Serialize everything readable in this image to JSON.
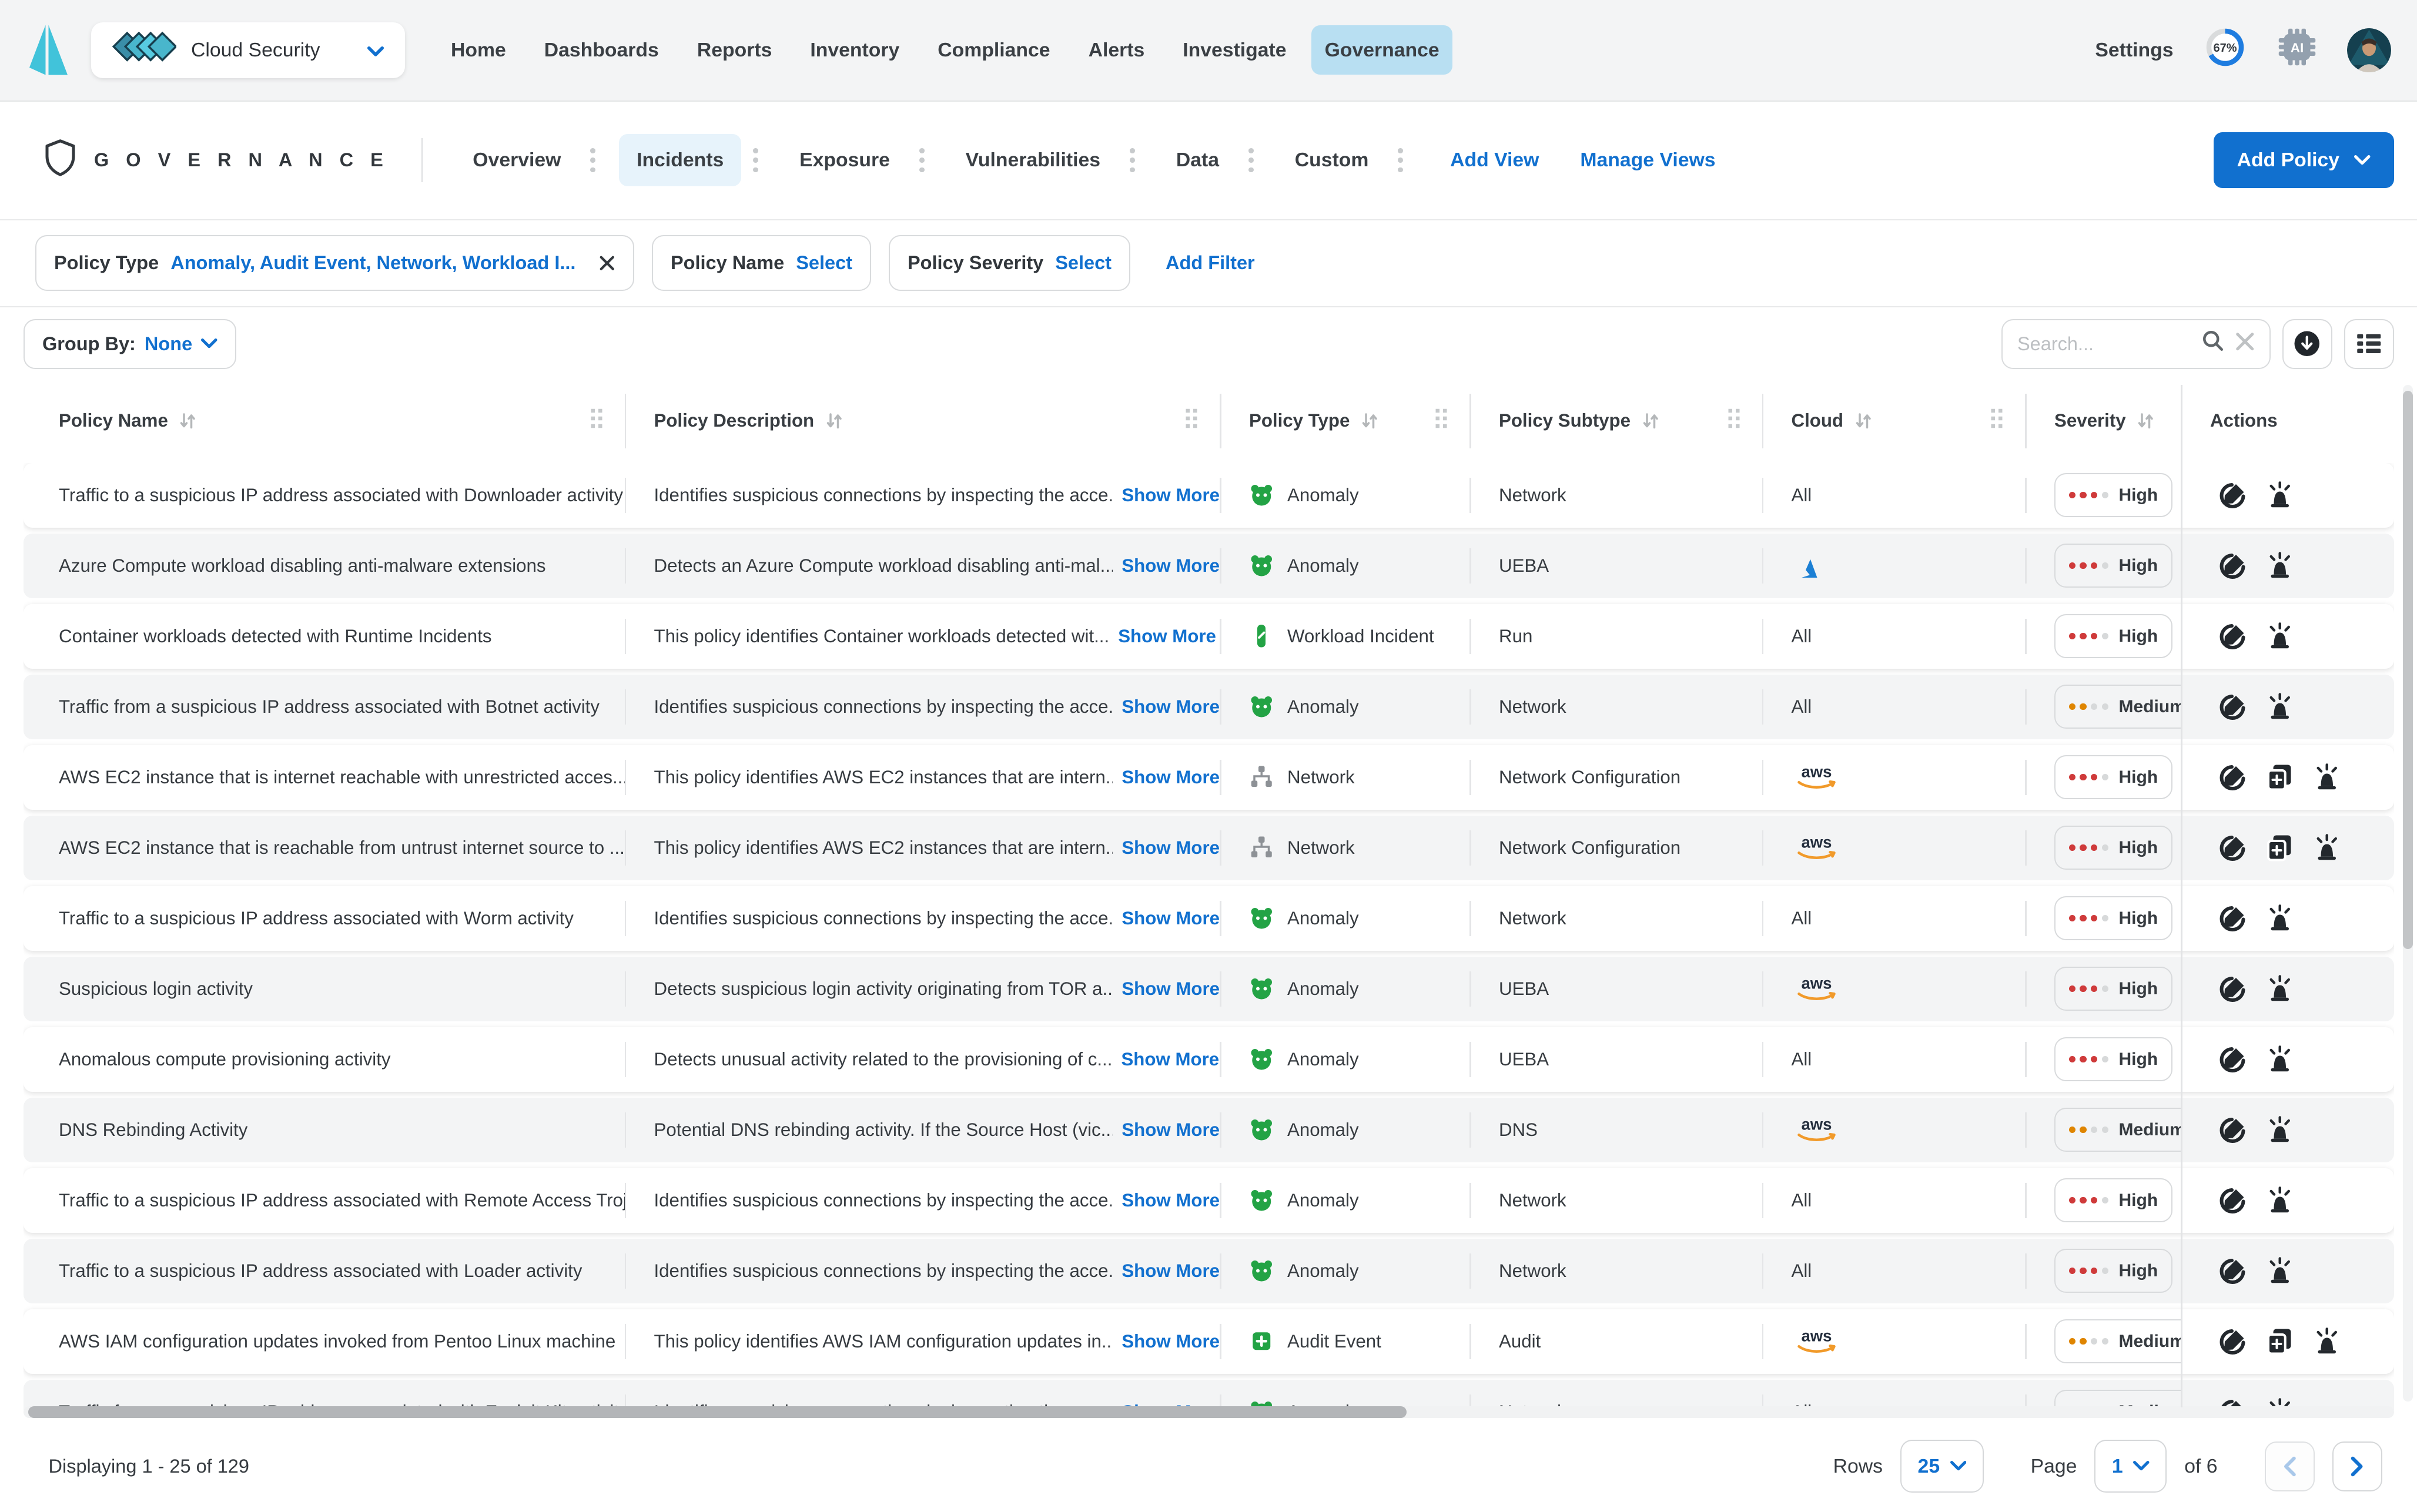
{
  "colors": {
    "accent_blue": "#1170cf",
    "active_nav_bg": "#b8dff2",
    "active_tab_bg": "#e7f3fb",
    "severity_high": "#cf3a3a",
    "severity_medium": "#df8500",
    "type_green": "#23a345",
    "aws_navy": "#252f3e",
    "aws_orange": "#f19a2a",
    "azure_blue": "#2e8de5"
  },
  "topnav": {
    "product_switcher": "Cloud Security",
    "items": [
      "Home",
      "Dashboards",
      "Reports",
      "Inventory",
      "Compliance",
      "Alerts",
      "Investigate",
      "Governance"
    ],
    "active_item": "Governance",
    "settings_label": "Settings",
    "progress_percent": "67%"
  },
  "header": {
    "title": "G O V E R N A N C E",
    "tabs": [
      {
        "label": "Overview"
      },
      {
        "label": "Incidents"
      },
      {
        "label": "Exposure"
      },
      {
        "label": "Vulnerabilities"
      },
      {
        "label": "Data"
      },
      {
        "label": "Custom"
      }
    ],
    "active_tab": "Incidents",
    "add_view_label": "Add View",
    "manage_views_label": "Manage Views",
    "add_policy_label": "Add Policy"
  },
  "filters": {
    "policy_type_label": "Policy Type",
    "policy_type_value": "Anomaly, Audit Event, Network, Workload I...",
    "policy_name_label": "Policy Name",
    "policy_name_value": "Select",
    "policy_severity_label": "Policy Severity",
    "policy_severity_value": "Select",
    "add_filter_label": "Add Filter"
  },
  "toolbar": {
    "group_by_label": "Group By:",
    "group_by_value": "None",
    "search_placeholder": "Search..."
  },
  "table": {
    "columns": [
      "Policy Name",
      "Policy Description",
      "Policy Type",
      "Policy Subtype",
      "Cloud",
      "Severity",
      "Actions"
    ],
    "show_more_label": "Show More",
    "cloud_all_label": "All",
    "rows": [
      {
        "name": "Traffic to a suspicious IP address associated with Downloader activity",
        "description": "Identifies suspicious connections by inspecting the acce...",
        "type": "Anomaly",
        "type_icon": "anomaly",
        "subtype": "Network",
        "cloud": "All",
        "severity": {
          "label": "High",
          "filled": 3,
          "color": "red"
        },
        "actions": [
          "edit",
          "alarm"
        ]
      },
      {
        "name": "Azure Compute workload disabling anti-malware extensions",
        "description": "Detects an Azure Compute workload disabling anti-mal...",
        "type": "Anomaly",
        "type_icon": "anomaly",
        "subtype": "UEBA",
        "cloud": "azure",
        "severity": {
          "label": "High",
          "filled": 3,
          "color": "red"
        },
        "actions": [
          "edit",
          "alarm"
        ]
      },
      {
        "name": "Container workloads detected with Runtime Incidents",
        "description": "This policy identifies Container workloads detected wit...",
        "type": "Workload Incident",
        "type_icon": "workload",
        "subtype": "Run",
        "cloud": "All",
        "severity": {
          "label": "High",
          "filled": 3,
          "color": "red"
        },
        "actions": [
          "edit",
          "alarm"
        ]
      },
      {
        "name": "Traffic from a suspicious IP address associated with Botnet activity",
        "description": "Identifies suspicious connections by inspecting the acce...",
        "type": "Anomaly",
        "type_icon": "anomaly",
        "subtype": "Network",
        "cloud": "All",
        "severity": {
          "label": "Medium",
          "filled": 2,
          "color": "orange"
        },
        "actions": [
          "edit",
          "alarm"
        ]
      },
      {
        "name": "AWS EC2 instance that is internet reachable with unrestricted acces...",
        "description": "This policy identifies AWS EC2 instances that are intern...",
        "type": "Network",
        "type_icon": "network",
        "subtype": "Network Configuration",
        "cloud": "aws",
        "severity": {
          "label": "High",
          "filled": 3,
          "color": "red"
        },
        "actions": [
          "edit",
          "clone",
          "alarm"
        ]
      },
      {
        "name": "AWS EC2 instance that is reachable from untrust internet source to ...",
        "description": "This policy identifies AWS EC2 instances that are intern...",
        "type": "Network",
        "type_icon": "network",
        "subtype": "Network Configuration",
        "cloud": "aws",
        "severity": {
          "label": "High",
          "filled": 3,
          "color": "red"
        },
        "actions": [
          "edit",
          "clone",
          "alarm"
        ]
      },
      {
        "name": "Traffic to a suspicious IP address associated with Worm activity",
        "description": "Identifies suspicious connections by inspecting the acce...",
        "type": "Anomaly",
        "type_icon": "anomaly",
        "subtype": "Network",
        "cloud": "All",
        "severity": {
          "label": "High",
          "filled": 3,
          "color": "red"
        },
        "actions": [
          "edit",
          "alarm"
        ]
      },
      {
        "name": "Suspicious login activity",
        "description": "Detects suspicious login activity originating from TOR a...",
        "type": "Anomaly",
        "type_icon": "anomaly",
        "subtype": "UEBA",
        "cloud": "aws",
        "severity": {
          "label": "High",
          "filled": 3,
          "color": "red"
        },
        "actions": [
          "edit",
          "alarm"
        ]
      },
      {
        "name": "Anomalous compute provisioning activity",
        "description": "Detects unusual activity related to the provisioning of c...",
        "type": "Anomaly",
        "type_icon": "anomaly",
        "subtype": "UEBA",
        "cloud": "All",
        "severity": {
          "label": "High",
          "filled": 3,
          "color": "red"
        },
        "actions": [
          "edit",
          "alarm"
        ]
      },
      {
        "name": "DNS Rebinding Activity",
        "description": "Potential DNS rebinding activity. If the Source Host (vic...",
        "type": "Anomaly",
        "type_icon": "anomaly",
        "subtype": "DNS",
        "cloud": "aws",
        "severity": {
          "label": "Medium",
          "filled": 2,
          "color": "orange"
        },
        "actions": [
          "edit",
          "alarm"
        ]
      },
      {
        "name": "Traffic to a suspicious IP address associated with Remote Access Troj...",
        "description": "Identifies suspicious connections by inspecting the acce...",
        "type": "Anomaly",
        "type_icon": "anomaly",
        "subtype": "Network",
        "cloud": "All",
        "severity": {
          "label": "High",
          "filled": 3,
          "color": "red"
        },
        "actions": [
          "edit",
          "alarm"
        ]
      },
      {
        "name": "Traffic to a suspicious IP address associated with Loader activity",
        "description": "Identifies suspicious connections by inspecting the acce...",
        "type": "Anomaly",
        "type_icon": "anomaly",
        "subtype": "Network",
        "cloud": "All",
        "severity": {
          "label": "High",
          "filled": 3,
          "color": "red"
        },
        "actions": [
          "edit",
          "alarm"
        ]
      },
      {
        "name": "AWS IAM configuration updates invoked from Pentoo Linux machine",
        "description": "This policy identifies AWS IAM configuration updates in...",
        "type": "Audit Event",
        "type_icon": "audit",
        "subtype": "Audit",
        "cloud": "aws",
        "severity": {
          "label": "Medium",
          "filled": 2,
          "color": "orange"
        },
        "actions": [
          "edit",
          "clone",
          "alarm"
        ]
      },
      {
        "name": "Traffic from a suspicious IP address associated with Exploit Kit activity",
        "description": "Identifies suspicious connections by inspecting the acce...",
        "type": "Anomaly",
        "type_icon": "anomaly",
        "subtype": "Network",
        "cloud": "All",
        "severity": {
          "label": "Medium",
          "filled": 2,
          "color": "orange"
        },
        "actions": [
          "edit",
          "alarm"
        ]
      }
    ]
  },
  "footer": {
    "displaying": "Displaying 1 - 25 of 129",
    "rows_label": "Rows",
    "rows_value": "25",
    "page_label": "Page",
    "page_value": "1",
    "of_label": "of 6"
  }
}
